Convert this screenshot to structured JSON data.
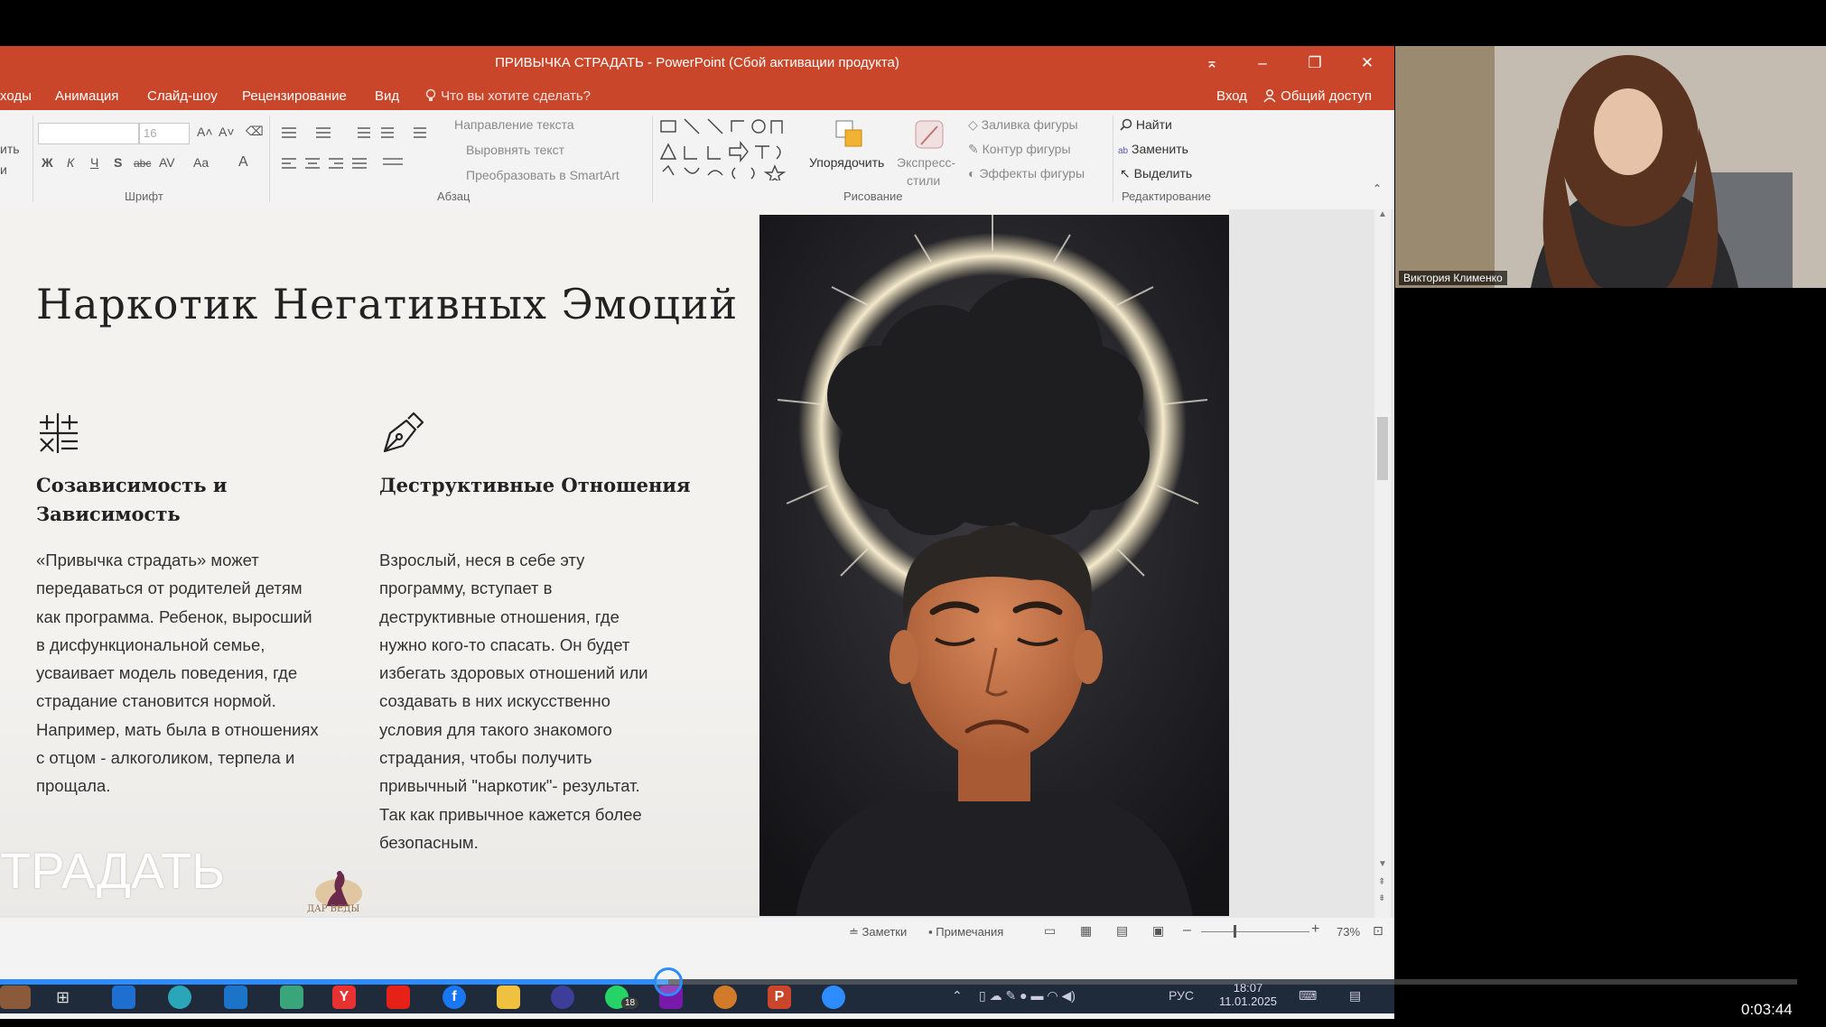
{
  "window": {
    "title": "ПРИВЫЧКА СТРАДАТЬ - PowerPoint (Сбой активации продукта)",
    "controls": [
      "⌅",
      "–",
      "❐",
      "✕"
    ]
  },
  "menu": {
    "items": [
      "ходы",
      "Анимация",
      "Слайд-шоу",
      "Рецензирование",
      "Вид"
    ],
    "tell_me": "Что вы хотите сделать?",
    "signin": "Вход",
    "share": "Общий доступ"
  },
  "ribbon": {
    "left_cut": [
      "ить",
      "и"
    ],
    "font": {
      "name_value": "",
      "size_value": "16",
      "bold": "Ж",
      "italic": "К",
      "underline": "Ч",
      "shadow": "S",
      "strike": "abc",
      "spacing": "AV",
      "case": "Aa",
      "color": "A",
      "grow": "A˄",
      "shrink": "A˅",
      "group_label": "Шрифт"
    },
    "paragraph": {
      "text_direction": "Направление текста",
      "align_text": "Выровнять текст",
      "smartart": "Преобразовать в SmartArt",
      "group_label": "Абзац"
    },
    "drawing": {
      "arrange": "Упорядочить",
      "quick_styles_1": "Экспресс-",
      "quick_styles_2": "стили",
      "shape_fill": "Заливка фигуры",
      "shape_outline": "Контур фигуры",
      "shape_effects": "Эффекты фигуры",
      "group_label": "Рисование"
    },
    "editing": {
      "find": "Найти",
      "replace": "Заменить",
      "select": "Выделить",
      "group_label": "Редактирование"
    }
  },
  "slide": {
    "title": "Наркотик Негативных Эмоций",
    "columns": [
      {
        "icon": "math-operations-icon",
        "heading_line1": "Созависимость и",
        "heading_line2": "Зависимость",
        "body": [
          "«Привычка страдать» может",
          "передаваться от родителей детям",
          "как программа. Ребенок, выросший",
          "в дисфункциональной семье,",
          "усваивает модель поведения, где",
          "страдание становится нормой.",
          "Например, мать была в отношениях",
          "с отцом - алкоголиком, терпела и",
          "прощала."
        ]
      },
      {
        "icon": "pen-nib-icon",
        "heading_line1": "Деструктивные Отношения",
        "heading_line2": "",
        "body": [
          "Взрослый, неся в себе эту",
          "программу, вступает в",
          "деструктивные отношения, где",
          "нужно кого-то спасать. Он будет",
          "избегать здоровых отношений или",
          "создавать в них искусственно",
          "условия для такого знакомого",
          "страдания, чтобы получить",
          "привычный \"наркотик\"- результат.",
          "Так как привычное кажется более",
          "безопасным."
        ]
      }
    ],
    "overlay_word": "ТРАДАТЬ",
    "logo_text": "ДАР ВЕДЫ"
  },
  "statusbar": {
    "notes": "Заметки",
    "comments": "Примечания",
    "zoom": "73%"
  },
  "taskbar": {
    "language": "РУС",
    "time": "18:07",
    "date": "11.01.2025",
    "whatsapp_badge": "18"
  },
  "video": {
    "participant_name": "Виктория Клименко",
    "elapsed": "0:03:44",
    "progress": 0.372
  },
  "colors": {
    "ppt_accent": "#c9462b",
    "video_accent": "#2d8cff"
  }
}
